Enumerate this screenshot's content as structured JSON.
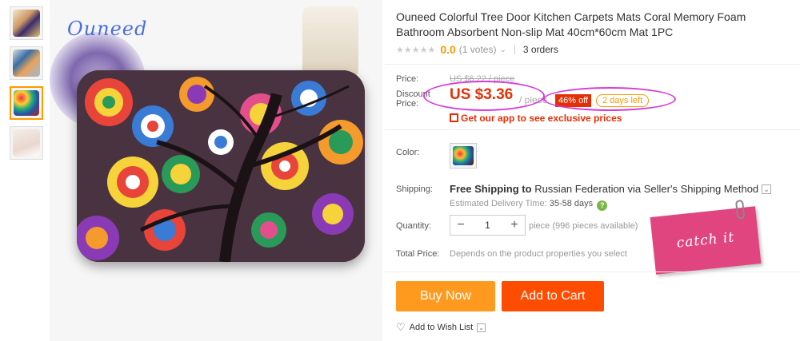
{
  "gallery": {
    "thumbnails": [
      "thumb-1",
      "thumb-2",
      "thumb-3",
      "thumb-4"
    ],
    "active_index": 2,
    "watermark": "Ouneed"
  },
  "product": {
    "title": "Ouneed Colorful Tree Door Kitchen Carpets Mats Coral Memory Foam Bathroom Absorbent Non-slip Mat 40cm*60cm Mat 1PC",
    "rating_value": "0.0",
    "votes": "(1 votes)",
    "orders": "3 orders"
  },
  "pricing": {
    "price_label": "Price:",
    "original_price": "US $6.22 / piece",
    "discount_label": "Discount Price:",
    "discount_price": "US $3.36",
    "per_piece": "/ piece",
    "discount_badge": "46% off",
    "time_left": "2 days left",
    "app_promo": "Get our app to see exclusive prices"
  },
  "options": {
    "color_label": "Color:",
    "shipping_label": "Shipping:",
    "shipping_text": "Free Shipping to",
    "shipping_country": "Russian Federation via Seller's Shipping Method",
    "delivery_label": "Estimated Delivery Time:",
    "delivery_days": "35-58 days",
    "quantity_label": "Quantity:",
    "quantity_value": "1",
    "availability": "piece (996 pieces available)",
    "total_label": "Total Price:",
    "total_text": "Depends on the product properties you select"
  },
  "sticker": {
    "text": "catch it"
  },
  "actions": {
    "buy_now": "Buy Now",
    "add_to_cart": "Add to Cart",
    "wish_list": "Add to Wish List"
  },
  "colors": {
    "price_red": "#e62e04",
    "buy_orange": "#ff9a1f",
    "cart_orange": "#ff4d00",
    "highlight_magenta": "#d63bd8",
    "sticker_pink": "#e0457f"
  }
}
